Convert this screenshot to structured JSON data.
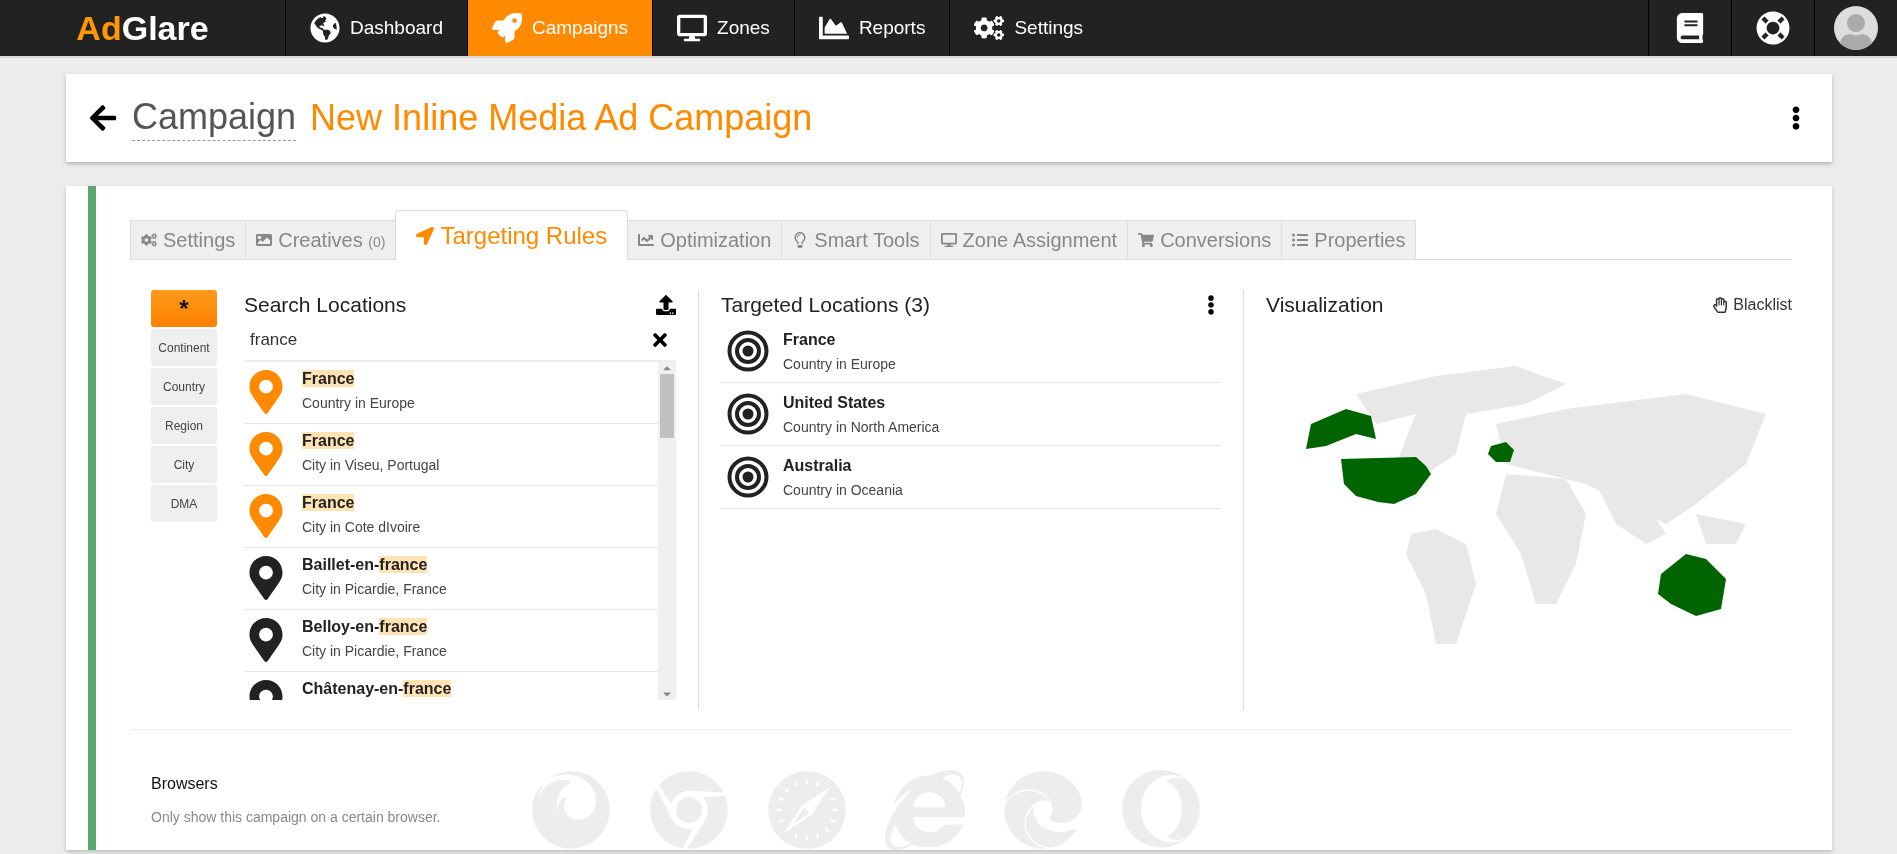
{
  "logo": {
    "accent": "Ad",
    "rest": "Glare"
  },
  "nav": [
    {
      "label": "Dashboard",
      "selected": false
    },
    {
      "label": "Campaigns",
      "selected": true
    },
    {
      "label": "Zones",
      "selected": false
    },
    {
      "label": "Reports",
      "selected": false
    },
    {
      "label": "Settings",
      "selected": false
    }
  ],
  "header": {
    "label": "Campaign",
    "title": "New Inline Media Ad Campaign"
  },
  "tabs": [
    {
      "label": "Settings",
      "selected": false
    },
    {
      "label": "Creatives",
      "count": "(0)",
      "selected": false
    },
    {
      "label": "Targeting Rules",
      "selected": true
    },
    {
      "label": "Optimization",
      "selected": false
    },
    {
      "label": "Smart Tools",
      "selected": false
    },
    {
      "label": "Zone Assignment",
      "selected": false
    },
    {
      "label": "Conversions",
      "selected": false
    },
    {
      "label": "Properties",
      "selected": false
    }
  ],
  "filters": [
    {
      "label": "*",
      "selected": true
    },
    {
      "label": "Continent",
      "selected": false
    },
    {
      "label": "Country",
      "selected": false
    },
    {
      "label": "Region",
      "selected": false
    },
    {
      "label": "City",
      "selected": false
    },
    {
      "label": "DMA",
      "selected": false
    }
  ],
  "search": {
    "title": "Search Locations",
    "value": "france",
    "results": [
      {
        "name": [
          {
            "text": "France",
            "highlighted": true
          }
        ],
        "detail": "Country in Europe",
        "color": "#ff8a00"
      },
      {
        "name": [
          {
            "text": "France",
            "highlighted": true
          }
        ],
        "detail": "City in Viseu, Portugal",
        "color": "#ff8a00"
      },
      {
        "name": [
          {
            "text": "France",
            "highlighted": true
          }
        ],
        "detail": "City in Cote dIvoire",
        "color": "#ff8a00"
      },
      {
        "name": [
          {
            "text": "Baillet-en-",
            "highlighted": false
          },
          {
            "text": "france",
            "highlighted": true
          }
        ],
        "detail": "City in Picardie, France",
        "color": "#222222"
      },
      {
        "name": [
          {
            "text": "Belloy-en-",
            "highlighted": false
          },
          {
            "text": "france",
            "highlighted": true
          }
        ],
        "detail": "City in Picardie, France",
        "color": "#222222"
      },
      {
        "name": [
          {
            "text": "Châtenay-en-",
            "highlighted": false
          },
          {
            "text": "france",
            "highlighted": true
          }
        ],
        "color": "#222222"
      }
    ]
  },
  "targeted": {
    "title": "Targeted Locations (3)",
    "items": [
      {
        "name": "France",
        "detail": "Country in Europe"
      },
      {
        "name": "United States",
        "detail": "Country in North America"
      },
      {
        "name": "Australia",
        "detail": "Country in Oceania"
      }
    ]
  },
  "visualization": {
    "title": "Visualization",
    "action": "Blacklist"
  },
  "browsers": {
    "title": "Browsers",
    "description": "Only show this campaign on a certain browser."
  }
}
